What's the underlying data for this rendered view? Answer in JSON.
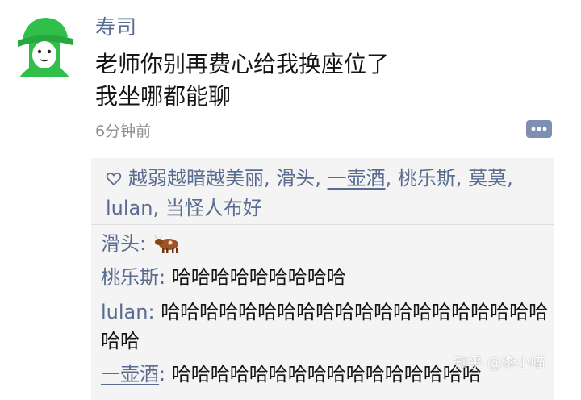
{
  "post": {
    "author": "寿司",
    "line1": "老师你别再费心给我换座位了",
    "line2": "我坐哪都能聊",
    "time": "6分钟前"
  },
  "likes": {
    "icon": "heart-outline-icon",
    "users": [
      "越弱越暗越美丽",
      "滑头",
      "一壶酒",
      "桃乐斯",
      "莫莫",
      "lulan",
      "当怪人布好"
    ],
    "separator": ", "
  },
  "comments": [
    {
      "name": "滑头",
      "colon": ": ",
      "text": "",
      "emoji": "cow-icon"
    },
    {
      "name": "桃乐斯",
      "colon": ": ",
      "text": "哈哈哈哈哈哈哈哈哈"
    },
    {
      "name": "lulan",
      "colon": ": ",
      "text": "哈哈哈哈哈哈哈哈哈哈哈哈哈哈哈哈哈哈哈哈哈哈"
    },
    {
      "name": "一壶酒",
      "colon": ": ",
      "text": "哈哈哈哈哈哈哈哈哈哈哈哈哈哈哈哈"
    }
  ],
  "watermark": "知乎 @李小喵",
  "colors": {
    "name_blue": "#5a6c8f",
    "panel_bg": "#f4f4f4",
    "avatar_green": "#2fbf4a"
  }
}
